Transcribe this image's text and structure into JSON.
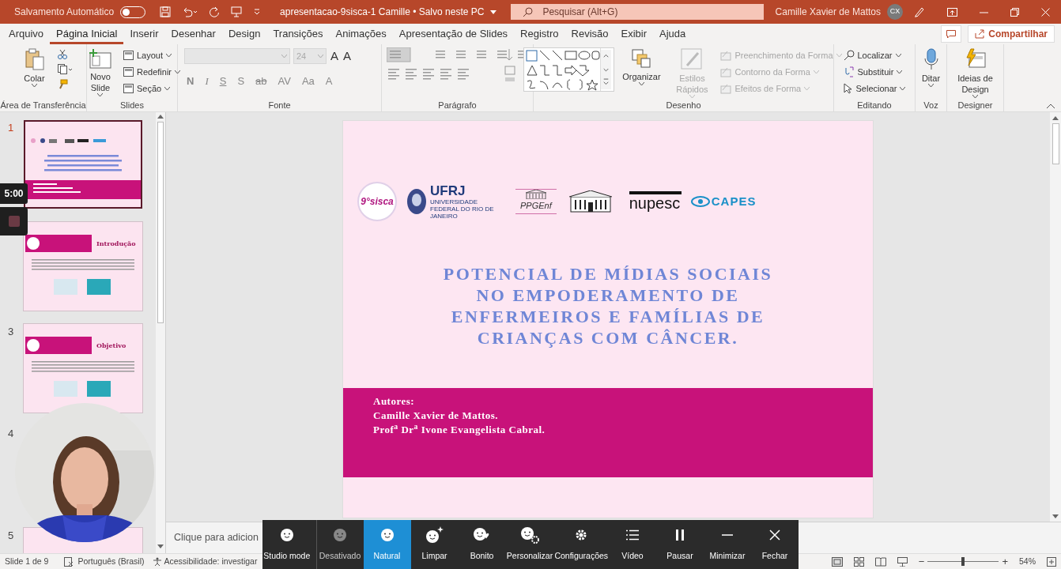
{
  "title_bar": {
    "autosave_label": "Salvamento Automático",
    "autosave_on": false,
    "document_title": "apresentacao-9sisca-1 Camille • Salvo neste PC",
    "search_placeholder": "Pesquisar (Alt+G)",
    "user_name": "Camille Xavier de Mattos",
    "user_initials": "CX"
  },
  "menu_tabs": [
    {
      "label": "Arquivo",
      "selected": false
    },
    {
      "label": "Página Inicial",
      "selected": true
    },
    {
      "label": "Inserir",
      "selected": false
    },
    {
      "label": "Desenhar",
      "selected": false
    },
    {
      "label": "Design",
      "selected": false
    },
    {
      "label": "Transições",
      "selected": false
    },
    {
      "label": "Animações",
      "selected": false
    },
    {
      "label": "Apresentação de Slides",
      "selected": false
    },
    {
      "label": "Registro",
      "selected": false
    },
    {
      "label": "Revisão",
      "selected": false
    },
    {
      "label": "Exibir",
      "selected": false
    },
    {
      "label": "Ajuda",
      "selected": false
    }
  ],
  "share_button": "Compartilhar",
  "ribbon": {
    "groups": [
      {
        "name": "Área de Transferência",
        "kind": "buttons",
        "items": [
          {
            "label": "Colar",
            "kind": "large",
            "disabled": false
          }
        ]
      },
      {
        "name": "Slides",
        "kind": "buttons",
        "items": [
          {
            "label": "Novo Slide",
            "kind": "large",
            "disabled": false
          },
          {
            "label": "Layout",
            "kind": "small",
            "disabled": false
          },
          {
            "label": "Redefinir",
            "kind": "small",
            "disabled": false
          },
          {
            "label": "Seção",
            "kind": "small",
            "disabled": false
          }
        ]
      },
      {
        "name": "Fonte",
        "kind": "font",
        "font_size": "24",
        "glyphs": [
          "A",
          "A",
          "N",
          "I",
          "S",
          "S",
          "ab",
          "AV",
          "Aa",
          "A"
        ]
      },
      {
        "name": "Parágrafo",
        "kind": "paragraph"
      },
      {
        "name": "Desenho",
        "kind": "shapes",
        "items": [
          {
            "label": "Organizar",
            "kind": "large",
            "disabled": false
          },
          {
            "label": "Estilos Rápidos",
            "kind": "large",
            "disabled": true
          },
          {
            "label": "Preenchimento da Forma",
            "kind": "small",
            "disabled": true
          },
          {
            "label": "Contorno da Forma",
            "kind": "small",
            "disabled": true
          },
          {
            "label": "Efeitos de Forma",
            "kind": "small",
            "disabled": true
          }
        ]
      },
      {
        "name": "Editando",
        "kind": "buttons",
        "items": [
          {
            "label": "Localizar",
            "kind": "small",
            "disabled": false
          },
          {
            "label": "Substituir",
            "kind": "small",
            "disabled": false
          },
          {
            "label": "Selecionar",
            "kind": "small",
            "disabled": false
          }
        ]
      },
      {
        "name": "Voz",
        "kind": "buttons",
        "items": [
          {
            "label": "Ditar",
            "kind": "large",
            "disabled": false
          }
        ]
      },
      {
        "name": "Designer",
        "kind": "buttons",
        "items": [
          {
            "label": "Ideias de Design",
            "kind": "large",
            "disabled": false
          }
        ]
      }
    ]
  },
  "thumbnails": [
    {
      "number": "1",
      "selected": true,
      "kind": "title"
    },
    {
      "selected": false,
      "kind": "section",
      "title": "Introdução"
    },
    {
      "number": "3",
      "selected": false,
      "kind": "section",
      "title": "Objetivo"
    },
    {
      "number": "4",
      "selected": false,
      "kind": "hidden"
    },
    {
      "number": "5",
      "selected": false,
      "kind": "hidden"
    }
  ],
  "timer": "5:00",
  "slide": {
    "logos": {
      "sisca": "9°sisca",
      "ufrj": "UFRJ",
      "ufrj_sub": "UNIVERSIDADE FEDERAL DO RIO DE JANEIRO",
      "ppgenf": "PPGEnf",
      "nupesc": "nupesc",
      "capes": "CAPES"
    },
    "title_lines": [
      "POTENCIAL DE MÍDIAS SOCIAIS",
      "NO EMPODERAMENTO DE",
      "ENFERMEIROS E FAMÍLIAS DE",
      "CRIANÇAS COM CÂNCER."
    ],
    "authors": [
      "Autores:",
      "Camille Xavier de Mattos.",
      "Prof$^{a}$ Dr$^{a}$ Ivone Evangelista Cabral."
    ]
  },
  "notes_placeholder": "Clique para adicion",
  "camera_toolbar": [
    {
      "label": "Studio mode",
      "kind": "face",
      "selected": false,
      "disabled": false
    },
    {
      "label": "Desativado",
      "kind": "face",
      "selected": false,
      "disabled": true
    },
    {
      "label": "Natural",
      "kind": "face",
      "selected": true,
      "disabled": false
    },
    {
      "label": "Limpar",
      "kind": "sparkle",
      "selected": false,
      "disabled": false
    },
    {
      "label": "Bonito",
      "kind": "heart",
      "selected": false,
      "disabled": false
    },
    {
      "label": "Personalizar",
      "kind": "gear-face",
      "selected": false,
      "disabled": false
    },
    {
      "label": "Configurações",
      "kind": "gear",
      "selected": false,
      "disabled": false
    },
    {
      "label": "Vídeo",
      "kind": "list",
      "selected": false,
      "disabled": false
    },
    {
      "label": "Pausar",
      "kind": "pause",
      "selected": false,
      "disabled": false
    },
    {
      "label": "Minimizar",
      "kind": "minimize",
      "selected": false,
      "disabled": false
    },
    {
      "label": "Fechar",
      "kind": "close",
      "selected": false,
      "disabled": false
    }
  ],
  "status_bar": {
    "slide_count": "Slide 1 de 9",
    "language": "Português (Brasil)",
    "accessibility": "Acessibilidade: investigar",
    "zoom_out": "−",
    "zoom_slider": {
      "level": 0.5
    },
    "zoom_in": "+",
    "zoom": "54%"
  }
}
